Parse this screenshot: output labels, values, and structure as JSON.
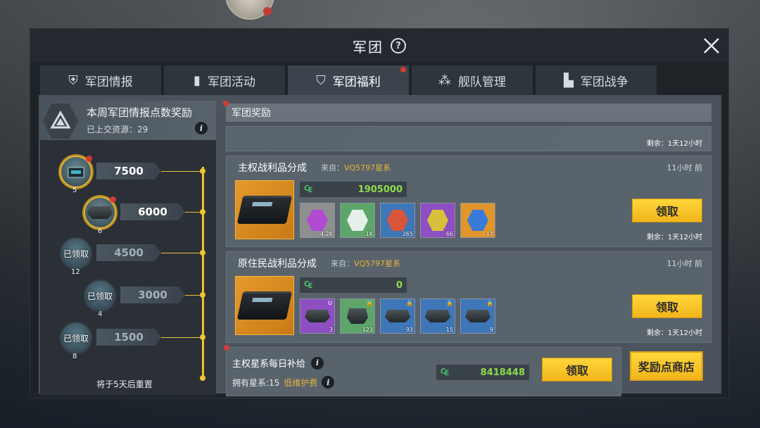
{
  "window": {
    "title": "军团",
    "help_symbol": "?"
  },
  "tabs": [
    {
      "label": "军团情报",
      "icon": "shield-icon",
      "glyph": "⛨"
    },
    {
      "label": "军团活动",
      "icon": "book-icon",
      "glyph": "▮"
    },
    {
      "label": "军团福利",
      "icon": "gift-icon",
      "glyph": "⛉",
      "active": true,
      "alert": true
    },
    {
      "label": "舰队管理",
      "icon": "fleet-icon",
      "glyph": "⁂"
    },
    {
      "label": "军团战争",
      "icon": "city-icon",
      "glyph": "▙"
    }
  ],
  "left_panel": {
    "title": "本周军团情报点数奖励",
    "subtitle": "已上交资源：29",
    "info_symbol": "i",
    "milestones": [
      {
        "points": "7500",
        "count": "5",
        "status": "claimable"
      },
      {
        "points": "6000",
        "count": "6",
        "status": "claimable"
      },
      {
        "points": "4500",
        "count": "12",
        "status": "claimed",
        "claimed_label": "已领取"
      },
      {
        "points": "3000",
        "count": "4",
        "status": "claimed",
        "claimed_label": "已领取"
      },
      {
        "points": "1500",
        "count": "8",
        "status": "claimed",
        "claimed_label": "已领取"
      }
    ],
    "reset_text": "将于5天后重置"
  },
  "rewards": {
    "section_title": "军团奖励",
    "partial_remaining": "剩余：1天12小时",
    "cards": [
      {
        "title": "主权战利品分成",
        "from_label": "来自：",
        "from_system": "VQ5797星系",
        "time": "11小时 前",
        "currency_symbol": "₠",
        "currency_value": "1905000",
        "items": [
          {
            "name": "purple-crystal",
            "qty": "4.2K",
            "color": "#9b6ad0"
          },
          {
            "name": "white-crystal",
            "qty": "1K",
            "color": "#5ea56a"
          },
          {
            "name": "red-ore",
            "qty": "265",
            "color": "#3f76b8"
          },
          {
            "name": "gold-ore",
            "qty": "66",
            "color": "#8e4fc2"
          },
          {
            "name": "blue-gem",
            "qty": "17",
            "color": "#e0962a"
          }
        ],
        "claim_label": "领取",
        "remaining": "剩余：1天12小时"
      },
      {
        "title": "原住民战利品分成",
        "from_label": "来自：",
        "from_system": "VQ5797星系",
        "time": "11小时 前",
        "currency_symbol": "₠",
        "currency_value": "0",
        "items": [
          {
            "name": "blueprint-chip",
            "qty": "3",
            "color": "#8e4fc2"
          },
          {
            "name": "module-case",
            "qty": "123",
            "color": "#5ea56a"
          },
          {
            "name": "ship-part",
            "qty": "93",
            "color": "#3f76b8"
          },
          {
            "name": "hull-blueprint",
            "qty": "15",
            "color": "#3f76b8"
          },
          {
            "name": "frigate-blueprint",
            "qty": "9",
            "color": "#3f76b8"
          }
        ],
        "claim_label": "领取",
        "remaining": "剩余：1天12小时"
      }
    ]
  },
  "daily": {
    "title": "主权星系每日补给",
    "owned": "拥有星系:15",
    "fee": "低维护费",
    "currency_symbol": "₠",
    "currency_value": "8418448",
    "claim_label": "领取"
  },
  "shop": {
    "label": "奖励点商店"
  }
}
